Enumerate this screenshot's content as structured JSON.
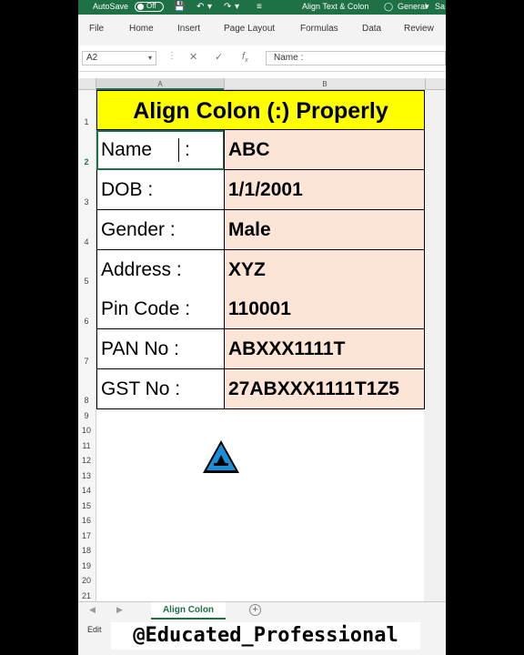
{
  "titlebar": {
    "autosave_label": "AutoSave",
    "autosave_state": "Off",
    "doc_title": "Align Text & Colon",
    "sensitivity": "General",
    "title_suffix": "Sa"
  },
  "ribbon": {
    "tabs": [
      "File",
      "Home",
      "Insert",
      "Page Layout",
      "Formulas",
      "Data",
      "Review"
    ]
  },
  "formula_bar": {
    "name_box": "A2",
    "formula_content": "Name    :"
  },
  "columns": [
    "A",
    "B"
  ],
  "rows": [
    "1",
    "2",
    "3",
    "4",
    "5",
    "6",
    "7",
    "8",
    "9",
    "10",
    "11",
    "12",
    "13",
    "14",
    "15",
    "16",
    "17",
    "18",
    "19",
    "20",
    "21"
  ],
  "sheet": {
    "title": "Align Colon (:) Properly",
    "entries": [
      {
        "label_text": "Name",
        "colon": ":",
        "value": "ABC"
      },
      {
        "label": "DOB :",
        "value": "1/1/2001"
      },
      {
        "label": "Gender :",
        "value": "Male"
      },
      {
        "label": "Address :",
        "value": "XYZ"
      },
      {
        "label": "Pin Code :",
        "value": "110001"
      },
      {
        "label": "PAN No :",
        "value": "ABXXX1111T"
      },
      {
        "label": "GST No :",
        "value": "27ABXXX1111T1Z5"
      }
    ]
  },
  "sheet_tab": "Align Colon",
  "status": "Edit",
  "watermark": "@Educated_Professional",
  "colors": {
    "excel_green": "#1e7145",
    "title_fill": "#ffff00",
    "value_fill": "#fce4d6",
    "logo_blue": "#1a8fd8"
  }
}
